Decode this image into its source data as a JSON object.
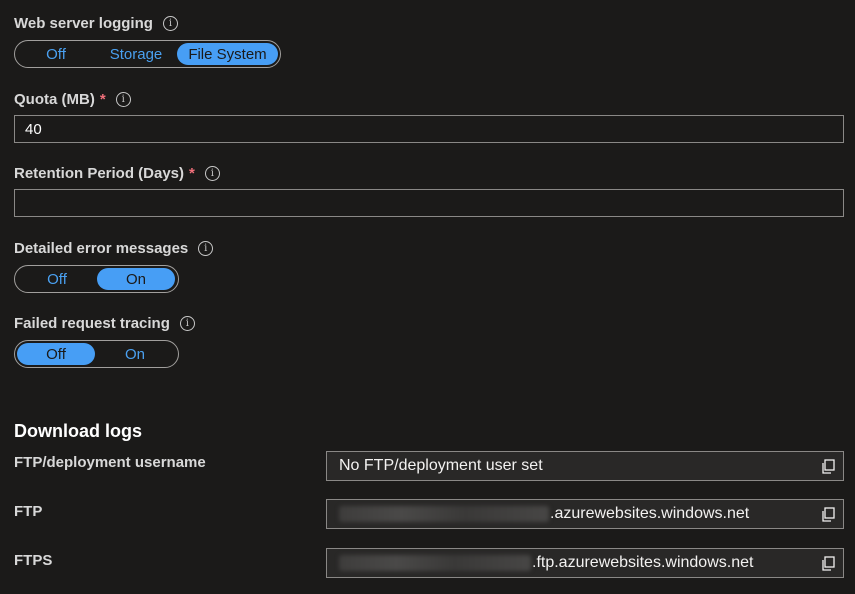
{
  "web_server_logging": {
    "label": "Web server logging",
    "options": [
      "Off",
      "Storage",
      "File System"
    ],
    "selected": "File System"
  },
  "quota": {
    "label": "Quota (MB)",
    "required_mark": "*",
    "value": "40"
  },
  "retention": {
    "label": "Retention Period (Days)",
    "required_mark": "*",
    "value": ""
  },
  "detailed_errors": {
    "label": "Detailed error messages",
    "options": [
      "Off",
      "On"
    ],
    "selected": "On"
  },
  "failed_request_tracing": {
    "label": "Failed request tracing",
    "options": [
      "Off",
      "On"
    ],
    "selected": "Off"
  },
  "download_logs": {
    "title": "Download logs",
    "ftp_username": {
      "label": "FTP/deployment username",
      "value": "No FTP/deployment user set"
    },
    "ftp": {
      "label": "FTP",
      "value_suffix": ".azurewebsites.windows.net"
    },
    "ftps": {
      "label": "FTPS",
      "value_suffix": ".ftp.azurewebsites.windows.net"
    }
  },
  "colors": {
    "background": "#1b1a19",
    "accent": "#479ef5",
    "required": "#f1707b"
  }
}
